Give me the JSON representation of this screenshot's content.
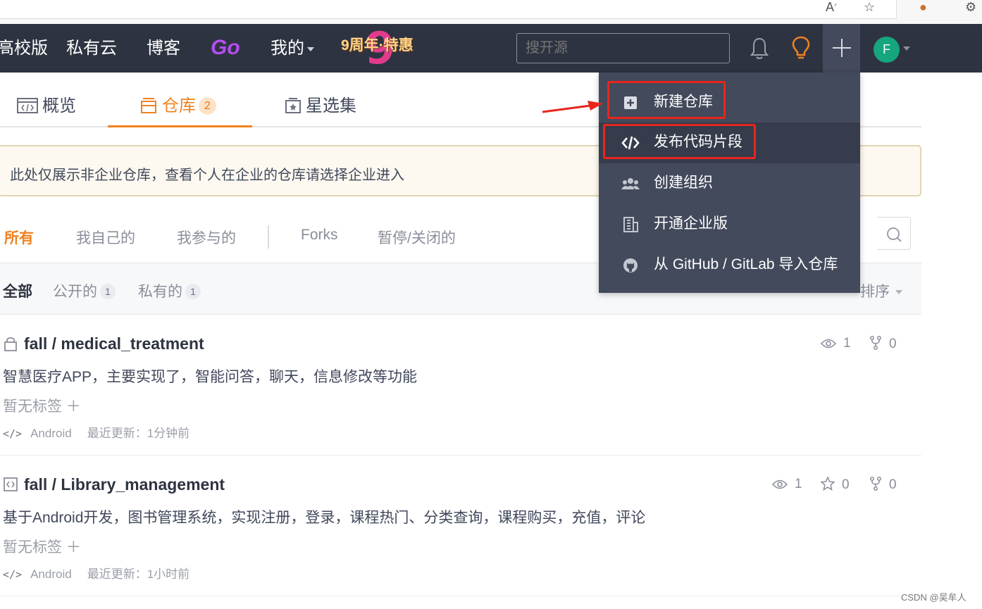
{
  "nav": {
    "items": [
      "高校版",
      "私有云",
      "博客"
    ],
    "go": "Go",
    "mine": "我的",
    "promo": "9周年·特惠",
    "promo_nine": "9",
    "search_placeholder": "搜开源",
    "avatar_letter": "F"
  },
  "tabs": {
    "overview": "概览",
    "repos": "仓库",
    "repos_count": "2",
    "collections": "星选集"
  },
  "notice": "此处仅展示非企业仓库，查看个人在企业的仓库请选择企业进入",
  "filters": [
    "所有",
    "我自己的",
    "我参与的",
    "Forks",
    "暂停/关闭的"
  ],
  "subfilters": {
    "all": "全部",
    "public": "公开的",
    "public_count": "1",
    "private": "私有的",
    "private_count": "1",
    "sort": "排序"
  },
  "repos": [
    {
      "name": "fall / medical_treatment",
      "description": "智慧医疗APP，主要实现了，智能问答，聊天，信息修改等功能",
      "tags": "暂无标签 ＋",
      "language": "Android",
      "updated": "最近更新：1分钟前",
      "watch": "1",
      "fork": "0"
    },
    {
      "name": "fall / Library_management",
      "description": "基于Android开发，图书管理系统，实现注册，登录，课程热门、分类查询，课程购买，充值，评论",
      "tags": "暂无标签 ＋",
      "language": "Android",
      "updated": "最近更新：1小时前",
      "watch": "1",
      "star": "0",
      "fork": "0"
    }
  ],
  "menu": {
    "items": [
      "新建仓库",
      "发布代码片段",
      "创建组织",
      "开通企业版",
      "从 GitHub / GitLab 导入仓库"
    ]
  },
  "lang_icon": "</>",
  "watermark": "CSDN @吴牟人",
  "colors": {
    "nav_bg": "#2e3341",
    "accent": "#f0821f",
    "menu_bg": "#434a5c",
    "highlight": "#e8261d",
    "go_purple": "#b44ef0"
  }
}
